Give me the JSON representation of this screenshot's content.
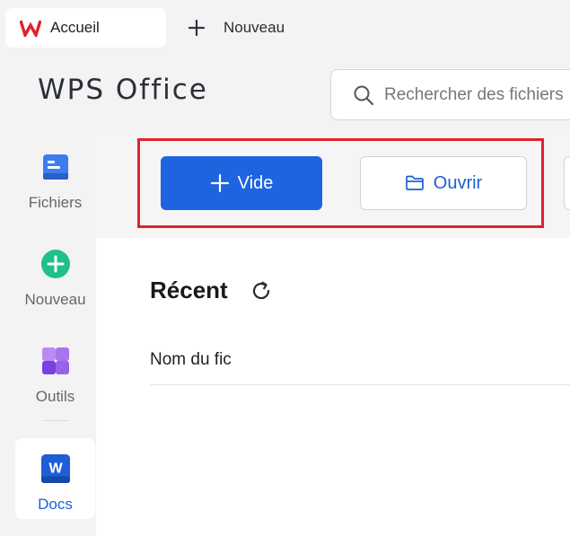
{
  "tabs": {
    "home_label": "Accueil",
    "new_label": "Nouveau"
  },
  "brand": {
    "name": "WPS Office"
  },
  "search": {
    "placeholder": "Rechercher des fichiers",
    "value": ""
  },
  "sidebar": {
    "items": [
      {
        "label": "Fichiers",
        "icon": "files-icon"
      },
      {
        "label": "Nouveau",
        "icon": "new-plus-circle-icon"
      },
      {
        "label": "Outils",
        "icon": "tools-icon"
      },
      {
        "label": "Docs",
        "icon": "word-docs-icon"
      }
    ],
    "active": "Docs"
  },
  "toolbar": {
    "vide_label": "Vide",
    "ouvrir_label": "Ouvrir"
  },
  "recent": {
    "title": "Récent",
    "column_name": "Nom du fic"
  },
  "colors": {
    "accent_blue": "#1e63df",
    "highlight_red": "#e3202e",
    "wps_red": "#e0202a",
    "new_green": "#1fc08a",
    "tools_purple": "#8a4ce0",
    "files_blue": "#3b7cf0"
  }
}
